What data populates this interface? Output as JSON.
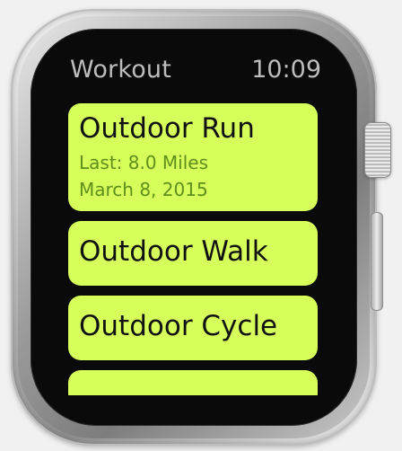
{
  "header": {
    "app_title": "Workout",
    "time": "10:09"
  },
  "workouts": [
    {
      "title": "Outdoor Run",
      "last": "Last: 8.0 Miles",
      "date": "March 8, 2015"
    },
    {
      "title": "Outdoor Walk"
    },
    {
      "title": "Outdoor Cycle"
    }
  ],
  "colors": {
    "card_bg": "#d6ff5c",
    "card_text": "#111111",
    "card_subtext": "#5f8e1b",
    "status_text": "#bdbdbd",
    "screen_bg": "#0a0a0a"
  }
}
